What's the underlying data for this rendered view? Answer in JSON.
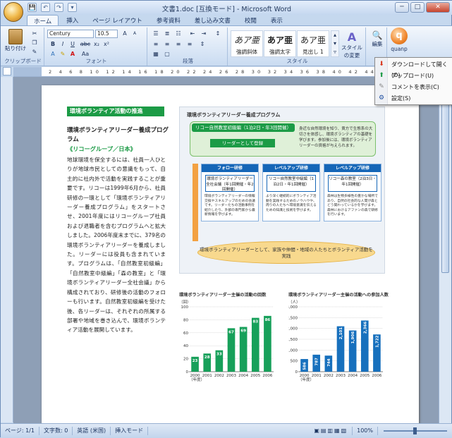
{
  "window": {
    "title": "文書1.doc [互換モード] - Microsoft Word",
    "min": "─",
    "max": "□",
    "close": "✕"
  },
  "qat": {
    "save": "💾",
    "undo": "↶",
    "redo": "↷",
    "more": "▾"
  },
  "tabs": [
    "ホーム",
    "挿入",
    "ページ レイアウト",
    "参考資料",
    "差し込み文書",
    "校閲",
    "表示"
  ],
  "ribbon": {
    "clipboard": {
      "paste": "貼り付け",
      "label": "クリップボード"
    },
    "font": {
      "name": "Century",
      "size": "10.5",
      "label": "フォント",
      "bold": "B",
      "italic": "I",
      "underline": "U",
      "strike": "abc",
      "sub": "x₂",
      "sup": "x²",
      "aa": "Aa",
      "grow": "A",
      "shrink": "A"
    },
    "paragraph": {
      "label": "段落"
    },
    "styles": {
      "label": "スタイル",
      "items": [
        {
          "sample": "あア亜",
          "name": "強調斜体"
        },
        {
          "sample": "あア亜",
          "name": "強調太字"
        },
        {
          "sample": "あア亜",
          "name": "見出し 1"
        }
      ],
      "change": "スタイルの変更"
    },
    "edit": {
      "label": "編集"
    },
    "quanp": {
      "label": "quanp",
      "logo": "q"
    }
  },
  "menu": {
    "items": [
      {
        "icon": "⬇",
        "label": "ダウンロードして開く(O)",
        "color": "#d9381e"
      },
      {
        "icon": "⬆",
        "label": "アップロード(U)",
        "color": "#1c9b46"
      },
      {
        "icon": "✎",
        "label": "コメントを表示(C)",
        "color": "#888888"
      },
      {
        "icon": "⚙",
        "label": "設定(S)",
        "color": "#1e4ea0"
      }
    ]
  },
  "ruler": {
    "numbers": "2 4 6 8 10 12 14 16 18 20 22 24 26 28 30 32 34 36 38 40 42 44 46 48"
  },
  "document": {
    "section_title": "環境ボランティア活動の推進",
    "heading": "環境ボランティアリーダー養成プログラム",
    "subheading": "《リコーグループ／日本》",
    "body": "地球環境を保全するには、社員一人ひとりが地球市民としての意識をもって、自主的に社内外で活動を実践することが重要です。リコーは1999年6月から、社員研修の一環として「環境ボランティアリーダー養成プログラム」をスタートさせ、2001年度にはリコーグループ社員および退職者を含むプログラムへと拡大しました。2006年度末までに、379名の環境ボランティアリーダーを養成しました。リーダーには役員も含まれています。プログラムは、「自然教室初級編」「自然教室中級編」「森の教室」と「環境ボランティアリーダー全社会議」から構成されており、研修後の活動のフォローも行います。自然教室初級編を受けた後、各リーダーは、それぞれの所属する部署や地域を巻き込んで、環境ボランティア活動を展開しています。",
    "diagram": {
      "title": "環境ボランティアリーダー養成プログラム",
      "top_head": "リコー自然教室初級編（1泊2日・年3回開催）",
      "top_sub": "リーダーとして登録",
      "top_note": "身近な自然環境を知り、貴方で生態系の大切さを体感し、環境ボランティアの基礎を学びます。参加後には、環境ボランティアリーダーの資格が与えられます。",
      "cols": [
        {
          "head": "フォロー研修",
          "mid": "環境ボランティアリーダー全社会議（年1回開催・年2回開催）",
          "txt": "環境ボランティアリーダーの情報交換やスキルアップのための会議です。リーダーたちの活動事例を紹介したり、外部の専門家から最新情報を学びます。"
        },
        {
          "head": "レベルアップ研修",
          "mid": "リコー自然教室中級編（1泊2日・年1回開催）",
          "txt": "より深く継続的にボランティア活動を実践するためのノウハウや、周りの人たちへ環境意識を伝えるための知識と技術を学びます。"
        },
        {
          "head": "レベルアップ研修",
          "mid": "リコー森の教室（2泊3日・年1回開催）",
          "txt": "森林は生物多様性の豊かな場所であり、自然の社会的な人間が森とどう関わっているかを学びます。森林におけるアファンの森で研修を行います。"
        }
      ],
      "oval": "環境ボランティアリーダーとして、家族や仲間・地域の人たちとボランティア活動を実践"
    }
  },
  "chart_data": [
    {
      "type": "bar",
      "title": "環境ボランティアリーダー主催の活動の回数",
      "unit": "（回）",
      "xlabel": "（年度）",
      "categories": [
        "2000",
        "2001",
        "2002",
        "2003",
        "2004",
        "2005",
        "2006"
      ],
      "values": [
        23,
        28,
        33,
        67,
        69,
        83,
        86
      ],
      "ylim": [
        0,
        100
      ],
      "yticks": [
        "100",
        "80",
        "60",
        "40",
        "20",
        "0"
      ],
      "color": "#17a05a"
    },
    {
      "type": "bar",
      "title": "環境ボランティアリーダー主催の活動への参加人数",
      "unit": "（人）",
      "xlabel": "（年度）",
      "categories": [
        "2000",
        "2001",
        "2002",
        "2003",
        "2004",
        "2005",
        "2006"
      ],
      "values": [
        586,
        787,
        744,
        2101,
        1906,
        2366,
        1722
      ],
      "ylim": [
        0,
        3000
      ],
      "yticks": [
        "3,000",
        "2,500",
        "2,000",
        "1,500",
        "1,000",
        "500",
        "0"
      ],
      "color": "#1770bd"
    }
  ],
  "status": {
    "page": "ページ: 1/1",
    "words": "文字数: 0",
    "lang": "英語 (米国)",
    "mode": "挿入モード",
    "zoom": "100%"
  }
}
